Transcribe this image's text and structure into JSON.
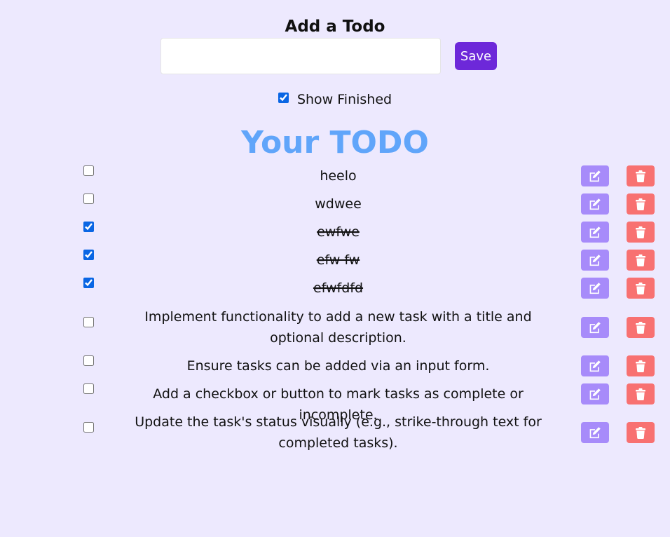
{
  "form": {
    "title": "Add a Todo",
    "input_value": "",
    "input_placeholder": "",
    "save_label": "Save"
  },
  "filter": {
    "show_finished_label": "Show Finished",
    "show_finished_checked": true
  },
  "list": {
    "heading": "Your TODO",
    "items": [
      {
        "text": "heelo",
        "done": false
      },
      {
        "text": "wdwee",
        "done": false
      },
      {
        "text": "ewfwe",
        "done": true
      },
      {
        "text": "efw fw",
        "done": true
      },
      {
        "text": "efwfdfd",
        "done": true
      },
      {
        "text": "Implement functionality to add a new task with a title and optional description.",
        "done": false
      },
      {
        "text": "Ensure tasks can be added via an input form.",
        "done": false
      },
      {
        "text": "Add a checkbox or button to mark tasks as complete or incomplete.",
        "done": false
      },
      {
        "text": "Update the task's status visually (e.g., strike-through text for completed tasks).",
        "done": false
      }
    ]
  },
  "icons": {
    "edit": "edit-icon",
    "delete": "trash-icon"
  },
  "colors": {
    "background": "#ede9fe",
    "save_button": "#6d28d9",
    "heading": "#60a5fa",
    "edit_button": "#a78bfa",
    "delete_button": "#f87171"
  }
}
